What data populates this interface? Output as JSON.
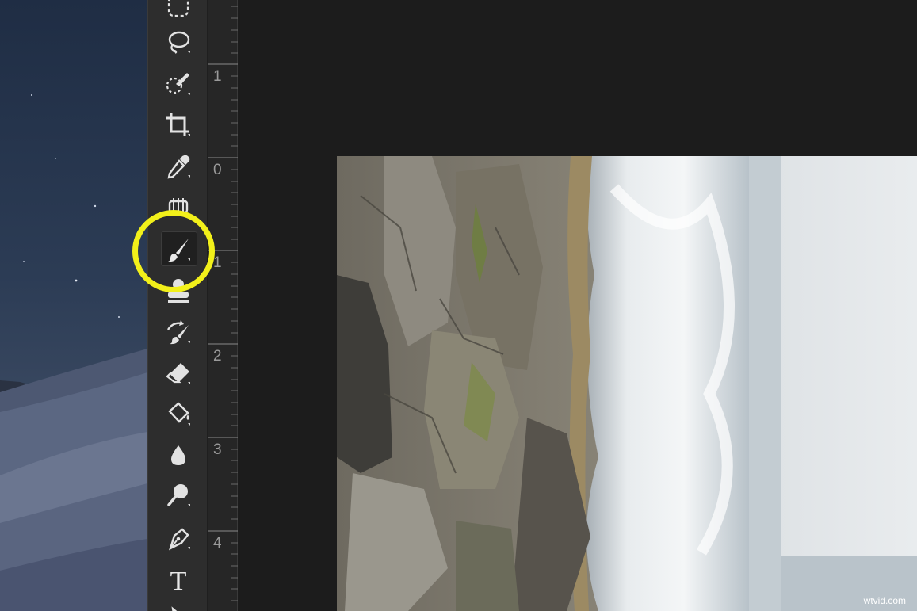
{
  "desktop": {
    "wallpaper": "mojave-night-dunes"
  },
  "toolbar": {
    "tools": [
      {
        "name": "Rectangular Marquee Tool",
        "icon": "marquee-icon"
      },
      {
        "name": "Lasso Tool",
        "icon": "lasso-icon"
      },
      {
        "name": "Quick Selection Tool",
        "icon": "quick-selection-icon"
      },
      {
        "name": "Crop Tool",
        "icon": "crop-icon"
      },
      {
        "name": "Eyedropper Tool",
        "icon": "eyedropper-icon"
      },
      {
        "name": "Spot Healing Brush Tool",
        "icon": "healing-brush-icon"
      },
      {
        "name": "Brush Tool",
        "icon": "brush-icon",
        "selected": true
      },
      {
        "name": "Clone Stamp Tool",
        "icon": "stamp-icon"
      },
      {
        "name": "History Brush Tool",
        "icon": "history-brush-icon"
      },
      {
        "name": "Eraser Tool",
        "icon": "eraser-icon"
      },
      {
        "name": "Paint Bucket Tool",
        "icon": "paint-bucket-icon"
      },
      {
        "name": "Blur Tool",
        "icon": "blur-icon"
      },
      {
        "name": "Dodge Tool",
        "icon": "dodge-icon"
      },
      {
        "name": "Pen Tool",
        "icon": "pen-icon"
      },
      {
        "name": "Type Tool",
        "icon": "type-icon",
        "glyph": "T"
      },
      {
        "name": "Path Selection Tool",
        "icon": "path-selection-icon"
      }
    ]
  },
  "ruler": {
    "labels": [
      "1",
      "0",
      "1",
      "2",
      "3",
      "4"
    ]
  },
  "canvas": {
    "image": "rotated seascape photo with rocks and waves"
  },
  "highlight": {
    "color": "#f2f01a"
  },
  "watermark": {
    "text": "wtvid.com"
  }
}
